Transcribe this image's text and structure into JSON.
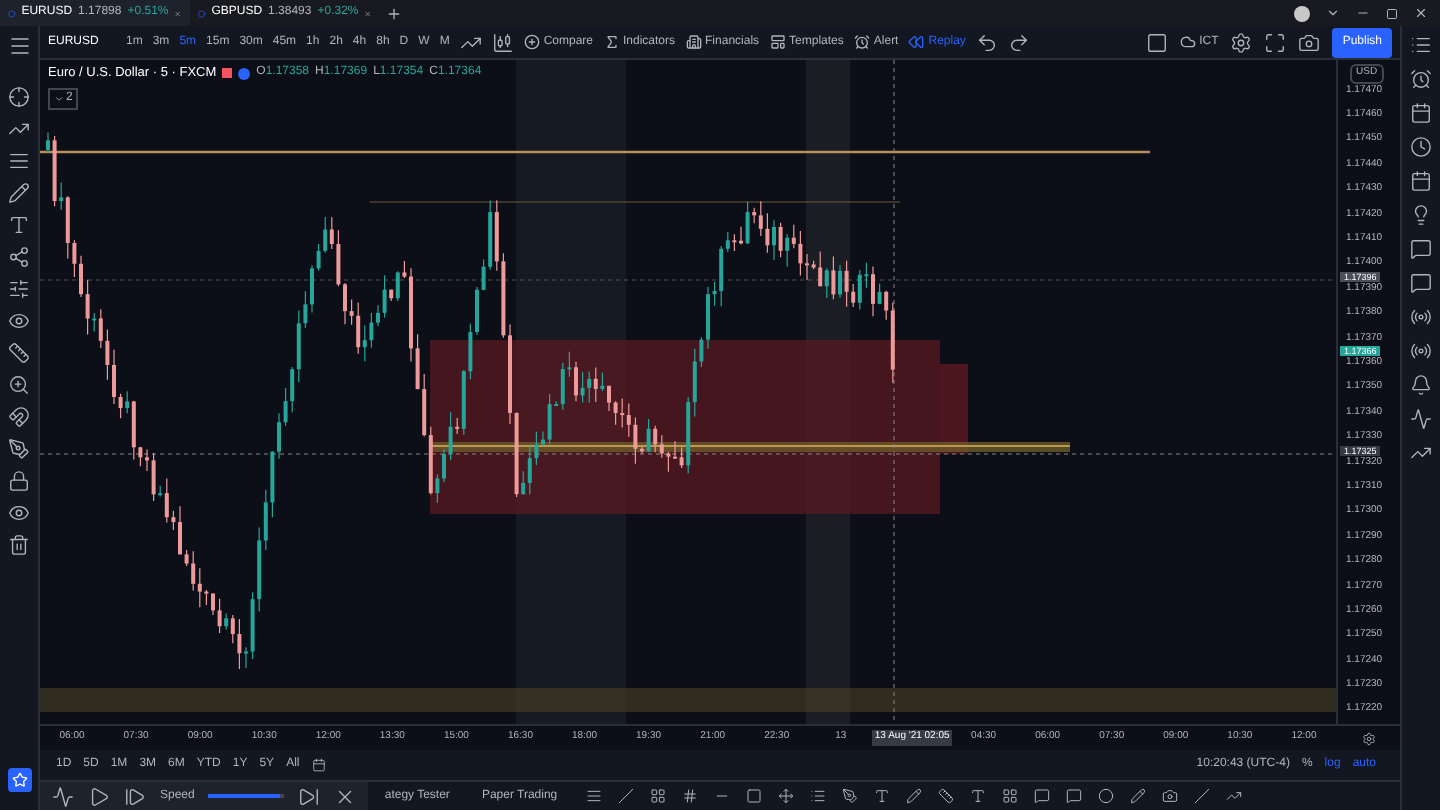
{
  "tabs": [
    {
      "symbol": "EURUSD",
      "price": "1.17898",
      "change": "+0.51%",
      "selected": true
    },
    {
      "symbol": "GBPUSD",
      "price": "1.38493",
      "change": "+0.32%",
      "selected": false
    }
  ],
  "toolbar": {
    "symbol": "EURUSD",
    "intervals": [
      {
        "label": "1m",
        "selected": false
      },
      {
        "label": "3m",
        "selected": false
      },
      {
        "label": "5m",
        "selected": true
      },
      {
        "label": "15m",
        "selected": false
      },
      {
        "label": "30m",
        "selected": false
      },
      {
        "label": "45m",
        "selected": false
      },
      {
        "label": "1h",
        "selected": false
      },
      {
        "label": "2h",
        "selected": false
      },
      {
        "label": "4h",
        "selected": false
      },
      {
        "label": "8h",
        "selected": false
      },
      {
        "label": "D",
        "selected": false
      },
      {
        "label": "W",
        "selected": false
      },
      {
        "label": "M",
        "selected": false
      }
    ],
    "compare": "Compare",
    "indicators": "Indicators",
    "financials": "Financials",
    "templates": "Templates",
    "alert": "Alert",
    "replay": "Replay",
    "layout": "ICT",
    "publish": "Publish"
  },
  "chart": {
    "title": "Euro / U.S. Dollar · 5 · FXCM",
    "ohlc": [
      {
        "label": "O",
        "value": "1.17358"
      },
      {
        "label": "H",
        "value": "1.17369"
      },
      {
        "label": "L",
        "value": "1.17354"
      },
      {
        "label": "C",
        "value": "1.17364"
      }
    ],
    "indicator_count": "2"
  },
  "price_axis": {
    "currency": "USD",
    "labels": [
      "1.17470",
      "1.17460",
      "1.17450",
      "1.17440",
      "1.17430",
      "1.17420",
      "1.17410",
      "1.17400",
      "1.17390",
      "1.17380",
      "1.17370",
      "1.17360",
      "1.17350",
      "1.17340",
      "1.17330",
      "1.17320",
      "1.17310",
      "1.17300",
      "1.17290",
      "1.17280",
      "1.17270",
      "1.17260",
      "1.17250",
      "1.17240",
      "1.17230",
      "1.17220"
    ],
    "markers": [
      {
        "value": "1.17396",
        "kind": "line"
      },
      {
        "value": "1.17366",
        "kind": "last"
      },
      {
        "value": "1.17325",
        "kind": "cursor"
      }
    ]
  },
  "time_axis": [
    {
      "kind": "tick",
      "label": "06:00"
    },
    {
      "kind": "tick",
      "label": "07:30"
    },
    {
      "kind": "tick",
      "label": "09:00"
    },
    {
      "kind": "tick",
      "label": "10:30"
    },
    {
      "kind": "tick",
      "label": "12:00"
    },
    {
      "kind": "tick",
      "label": "13:30"
    },
    {
      "kind": "tick",
      "label": "15:00"
    },
    {
      "kind": "tick",
      "label": "16:30"
    },
    {
      "kind": "tick",
      "label": "18:00"
    },
    {
      "kind": "tick",
      "label": "19:30"
    },
    {
      "kind": "tick",
      "label": "21:00"
    },
    {
      "kind": "tick",
      "label": "22:30"
    },
    {
      "kind": "tick",
      "label": "13"
    },
    {
      "kind": "cursor",
      "label": "13 Aug '21",
      "time": "02:05"
    },
    {
      "kind": "tick",
      "label": "04:30"
    },
    {
      "kind": "tick",
      "label": "06:00"
    },
    {
      "kind": "tick",
      "label": "07:30"
    },
    {
      "kind": "tick",
      "label": "09:00"
    },
    {
      "kind": "tick",
      "label": "10:30"
    },
    {
      "kind": "tick",
      "label": "12:00"
    }
  ],
  "ranges": [
    "1D",
    "5D",
    "1M",
    "3M",
    "6M",
    "YTD",
    "1Y",
    "5Y",
    "All"
  ],
  "status": {
    "clock": "10:20:43 (UTC-4)",
    "percent": "%",
    "log": "log",
    "auto": "auto"
  },
  "replay_bar": {
    "speed_label": "Speed",
    "speed": {
      "level": 0.95
    }
  },
  "bottom_tabs": [
    "ategy Tester",
    "Paper Trading"
  ]
}
